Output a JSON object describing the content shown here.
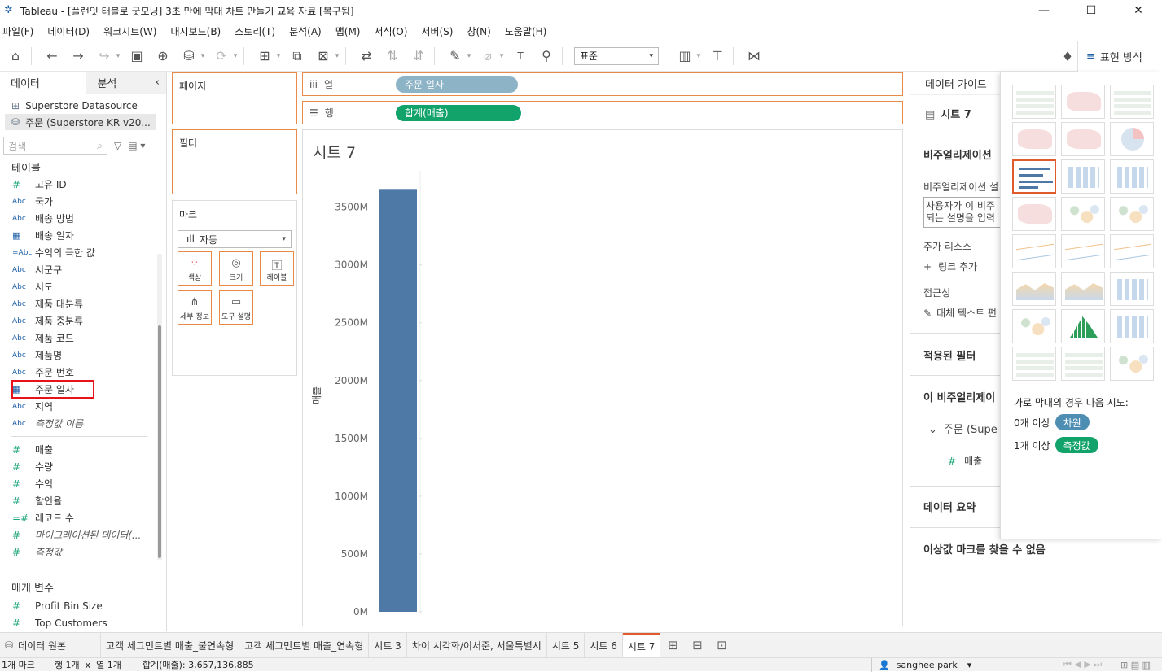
{
  "window": {
    "title": "Tableau - [플랜잇 태블로 굿모닝] 3초 만에 막대 차트 만들기 교육 자료 [복구됨]"
  },
  "menu": [
    "파일(F)",
    "데이터(D)",
    "워크시트(W)",
    "대시보드(B)",
    "스토리(T)",
    "분석(A)",
    "맵(M)",
    "서식(O)",
    "서버(S)",
    "창(N)",
    "도움말(H)"
  ],
  "toolbar": {
    "fit_select": "표준",
    "show_me_label": "표현 방식"
  },
  "data_pane": {
    "tab_data": "데이터",
    "tab_analysis": "분석",
    "datasources": [
      "Superstore Datasource",
      "주문 (Superstore KR v20..."
    ],
    "search_placeholder": "검색",
    "tables_label": "테이블",
    "dimensions": [
      {
        "icon": "#",
        "name": "고유 ID"
      },
      {
        "icon": "Abc",
        "name": "국가"
      },
      {
        "icon": "Abc",
        "name": "배송 방법"
      },
      {
        "icon": "cal",
        "name": "배송 일자"
      },
      {
        "icon": "=Abc",
        "name": "수익의 극한 값"
      },
      {
        "icon": "Abc",
        "name": "시군구"
      },
      {
        "icon": "Abc",
        "name": "시도"
      },
      {
        "icon": "Abc",
        "name": "제품 대분류"
      },
      {
        "icon": "Abc",
        "name": "제품 중분류"
      },
      {
        "icon": "Abc",
        "name": "제품 코드"
      },
      {
        "icon": "Abc",
        "name": "제품명"
      },
      {
        "icon": "Abc",
        "name": "주문 번호"
      },
      {
        "icon": "cal",
        "name": "주문 일자"
      },
      {
        "icon": "Abc",
        "name": "지역"
      },
      {
        "icon": "Abc",
        "name": "측정값 이름"
      }
    ],
    "measures": [
      {
        "icon": "#",
        "name": "매출"
      },
      {
        "icon": "#",
        "name": "수량"
      },
      {
        "icon": "#",
        "name": "수익"
      },
      {
        "icon": "#",
        "name": "할인율"
      },
      {
        "icon": "=#",
        "name": "레코드 수"
      },
      {
        "icon": "#",
        "name": "마이그레이션된 데이터(..."
      },
      {
        "icon": "#",
        "name": "측정값"
      }
    ],
    "params_label": "매개 변수",
    "params": [
      {
        "icon": "#",
        "name": "Profit Bin Size"
      },
      {
        "icon": "#",
        "name": "Top Customers"
      }
    ]
  },
  "shelves": {
    "pages": "페이지",
    "filters": "필터",
    "marks": "마크",
    "mark_type": "자동",
    "mark_buttons": [
      "색상",
      "크기",
      "레이블",
      "세부 정보",
      "도구 설명"
    ],
    "columns_label": "열",
    "rows_label": "행",
    "columns_pill": "주문 일자",
    "rows_pill": "합계(매출)"
  },
  "view": {
    "sheet_title": "시트 7"
  },
  "chart_data": {
    "type": "bar",
    "categories": [
      ""
    ],
    "values": [
      3657136885
    ],
    "ylabel": "매출",
    "ylim": [
      0,
      3800000000
    ],
    "yticks": [
      "0M",
      "500M",
      "1000M",
      "1500M",
      "2000M",
      "2500M",
      "3000M",
      "3500M"
    ],
    "color": "#4e79a7"
  },
  "guide": {
    "title": "데이터 가이드",
    "sheet": "시트 7",
    "viz_desc_title": "비주얼리제이션",
    "viz_desc_label": "비주얼리제이션 설",
    "viz_desc_box1": "사용자가 이 비주",
    "viz_desc_box2": "되는 설명을 입력",
    "extra_resources": "추가 리소스",
    "add_link": "링크 추가",
    "accessibility": "접근성",
    "alt_text": "대체 텍스트 편",
    "applied_filters": "적용된 필터",
    "this_viz": "이 비주얼리제이",
    "source_row": "주문 (Supe",
    "measure_row": "매출",
    "data_summary": "데이터 요약",
    "outliers": "이상값 마크를 찾을 수 없음"
  },
  "showme": {
    "hint": "가로 막대의 경우 다음 시도:",
    "row1_label": "0개 이상",
    "row1_chip": "차원",
    "row2_label": "1개 이상",
    "row2_chip": "측정값"
  },
  "sheet_tabs": [
    "데이터 원본",
    "고객 세그먼트별 매출_불연속형",
    "고객 세그먼트별 매출_연속형",
    "시트 3",
    "차이 시각화/이서준, 서울특별시",
    "시트 5",
    "시트 6",
    "시트 7"
  ],
  "status": {
    "marks": "1개 마크",
    "rowcol": "행 1개  x  열 1개",
    "sum": "합계(매출): 3,657,136,885",
    "user": "sanghee park"
  },
  "colors": {
    "accent": "#e05a2b",
    "bar": "#4e79a7",
    "dimension": "#1f5fa6",
    "measure": "#1aa37a"
  }
}
